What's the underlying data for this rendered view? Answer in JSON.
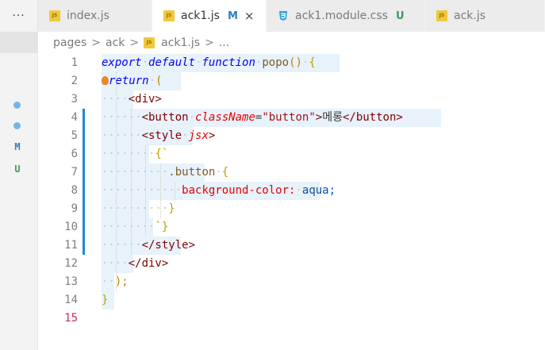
{
  "activity": {
    "more": "···",
    "status_letters": [
      {
        "letter": "M",
        "color": "#2b7fc4"
      },
      {
        "letter": "U",
        "color": "#3d9b5a"
      }
    ]
  },
  "tabs": [
    {
      "label": "index.js",
      "icon": "js-file-icon",
      "status": "",
      "active": false
    },
    {
      "label": "ack1.js",
      "icon": "js-file-icon",
      "status": "M",
      "active": true,
      "close": "×"
    },
    {
      "label": "ack1.module.css",
      "icon": "css-file-icon",
      "status": "U",
      "active": false
    },
    {
      "label": "ack.js",
      "icon": "js-file-icon",
      "status": "",
      "active": false
    }
  ],
  "js_badge": "JS",
  "breadcrumb": {
    "folder1": "pages",
    "folder2": "ack",
    "file": "ack1.js",
    "more": "..."
  },
  "editor": {
    "current_line": 15,
    "lines": [
      {
        "n": "1",
        "tokens": [
          [
            "kw",
            "export"
          ],
          [
            "ws",
            "·"
          ],
          [
            "kw",
            "default"
          ],
          [
            "ws",
            "·"
          ],
          [
            "kw",
            "function"
          ],
          [
            "ws",
            "·"
          ],
          [
            "fn",
            "popo"
          ],
          [
            "paren",
            "()"
          ],
          [
            "ws",
            "·"
          ],
          [
            "brace",
            "{"
          ]
        ]
      },
      {
        "n": "2",
        "tokens": [
          [
            "kw",
            "return"
          ],
          [
            "ws",
            "·"
          ],
          [
            "paren",
            "("
          ]
        ]
      },
      {
        "n": "3",
        "tokens": [
          [
            "ws",
            "····"
          ],
          [
            "tag",
            "<div>"
          ]
        ]
      },
      {
        "n": "4",
        "tokens": [
          [
            "ws",
            "······"
          ],
          [
            "tag",
            "<button"
          ],
          [
            "ws",
            "·"
          ],
          [
            "attr",
            "className"
          ],
          [
            "punc",
            "="
          ],
          [
            "str",
            "\"button\""
          ],
          [
            "tag",
            ">"
          ],
          [
            "punc",
            "메롱"
          ],
          [
            "tag",
            "</button>"
          ]
        ]
      },
      {
        "n": "5",
        "tokens": [
          [
            "ws",
            "······"
          ],
          [
            "tag",
            "<style"
          ],
          [
            "ws",
            "·"
          ],
          [
            "attr",
            "jsx"
          ],
          [
            "tag",
            ">"
          ]
        ]
      },
      {
        "n": "6",
        "tokens": [
          [
            "ws",
            "········"
          ],
          [
            "brace",
            "{`"
          ]
        ]
      },
      {
        "n": "7",
        "tokens": [
          [
            "ws",
            "··········"
          ],
          [
            "fn",
            ".button"
          ],
          [
            "ws",
            "·"
          ],
          [
            "brace",
            "{"
          ]
        ]
      },
      {
        "n": "8",
        "tokens": [
          [
            "ws",
            "············"
          ],
          [
            "cssprop",
            "background-color:"
          ],
          [
            "ws",
            "·"
          ],
          [
            "cssval",
            "aqua;"
          ]
        ]
      },
      {
        "n": "9",
        "tokens": [
          [
            "ws",
            "··········"
          ],
          [
            "brace",
            "}"
          ]
        ]
      },
      {
        "n": "10",
        "tokens": [
          [
            "ws",
            "········"
          ],
          [
            "brace",
            "`}"
          ]
        ]
      },
      {
        "n": "11",
        "tokens": [
          [
            "ws",
            "······"
          ],
          [
            "tag",
            "</style>"
          ]
        ]
      },
      {
        "n": "12",
        "tokens": [
          [
            "ws",
            "····"
          ],
          [
            "tag",
            "</div>"
          ]
        ]
      },
      {
        "n": "13",
        "tokens": [
          [
            "ws",
            "··"
          ],
          [
            "paren",
            ");"
          ]
        ]
      },
      {
        "n": "14",
        "tokens": [
          [
            "brace",
            "}"
          ]
        ]
      },
      {
        "n": "15",
        "tokens": []
      }
    ]
  }
}
